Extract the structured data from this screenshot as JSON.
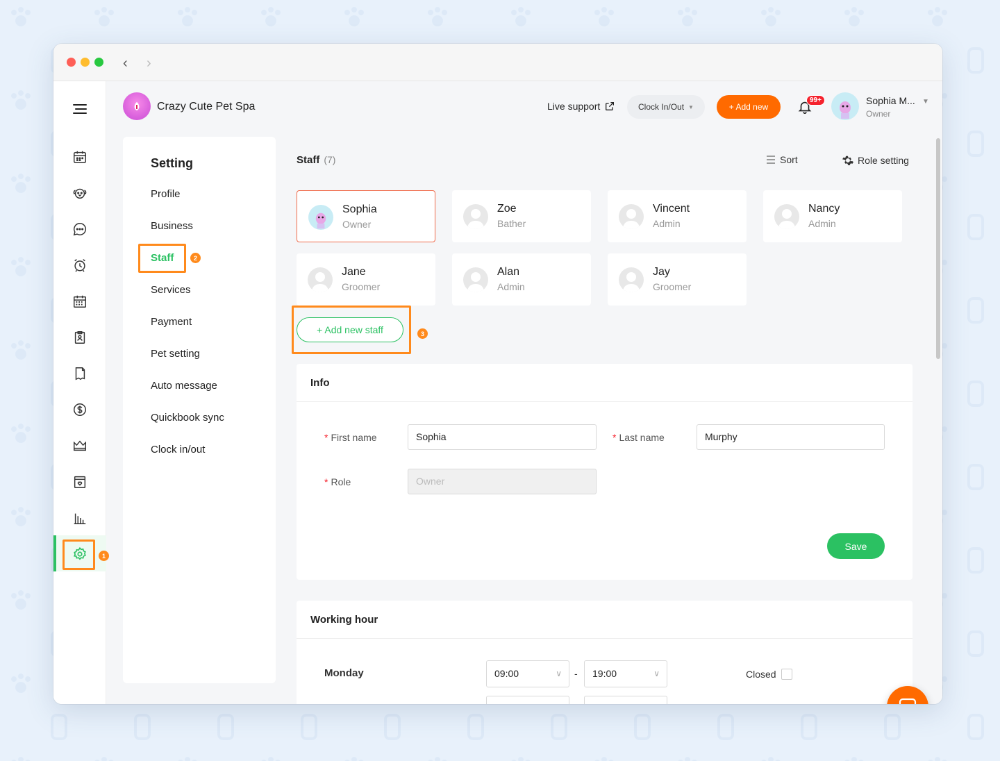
{
  "app": {
    "brand": "Crazy Cute Pet Spa"
  },
  "topbar": {
    "live_support": "Live support",
    "clock_label": "Clock In/Out",
    "add_new_label": "+ Add new",
    "notif_badge": "99+",
    "user_name": "Sophia M...",
    "user_role": "Owner"
  },
  "settings": {
    "title": "Setting",
    "items": [
      "Profile",
      "Business",
      "Staff",
      "Services",
      "Payment",
      "Pet setting",
      "Auto message",
      "Quickbook sync",
      "Clock in/out"
    ]
  },
  "staff": {
    "title": "Staff",
    "count": "(7)",
    "sort_label": "Sort",
    "role_setting_label": "Role setting",
    "members": [
      {
        "name": "Sophia",
        "role": "Owner"
      },
      {
        "name": "Zoe",
        "role": "Bather"
      },
      {
        "name": "Vincent",
        "role": "Admin"
      },
      {
        "name": "Nancy",
        "role": "Admin"
      },
      {
        "name": "Jane",
        "role": "Groomer"
      },
      {
        "name": "Alan",
        "role": "Admin"
      },
      {
        "name": "Jay",
        "role": "Groomer"
      }
    ],
    "add_label": "+ Add new staff"
  },
  "info": {
    "title": "Info",
    "first_name_label": "First name",
    "first_name_value": "Sophia",
    "last_name_label": "Last name",
    "last_name_value": "Murphy",
    "role_label": "Role",
    "role_placeholder": "Owner",
    "required_mark": "*",
    "save_label": "Save"
  },
  "working_hour": {
    "title": "Working hour",
    "day": "Monday",
    "start": "09:00",
    "separator": "-",
    "end": "19:00",
    "closed_label": "Closed"
  },
  "callouts": {
    "one": "1",
    "two": "2",
    "three": "3"
  },
  "colors": {
    "accent": "#2bc162",
    "primary": "#ff6a00",
    "callout": "#ff8a1c"
  }
}
